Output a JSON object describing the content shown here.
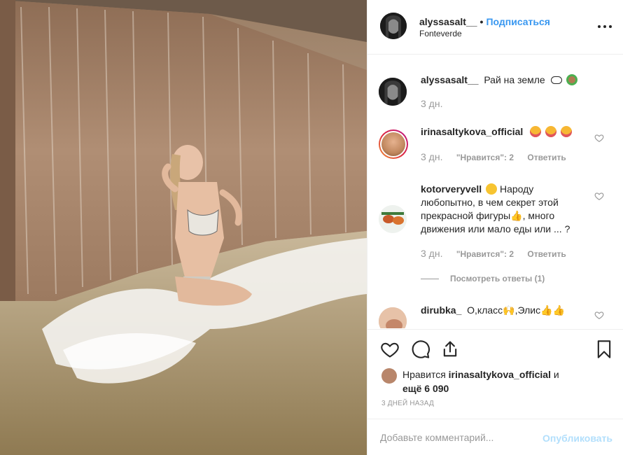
{
  "post": {
    "username": "alyssasalt__",
    "follow_label": "Подписаться",
    "dot": "•",
    "location": "Fonteverde",
    "photo_alt": "Woman sitting under a waterfall fountain"
  },
  "comments": [
    {
      "username": "alyssasalt__",
      "text": "Рай на земле",
      "emojis": [
        "cloud",
        "monkey"
      ],
      "time": "3 дн.",
      "likes": "",
      "reply": ""
    },
    {
      "username": "irinasaltykova_official",
      "text": "",
      "emojis": [
        "tongue-face",
        "tongue-face",
        "tongue-face"
      ],
      "time": "3 дн.",
      "likes": "\"Нравится\": 2",
      "reply": "Ответить"
    },
    {
      "username": "kotorveryvell",
      "text": "Народу любопытно, в чем секрет этой прекрасной фигуры👍, много движения или мало еды или ... ?",
      "emojis": [
        "thinking-face"
      ],
      "time": "3 дн.",
      "likes": "\"Нравится\": 2",
      "reply": "Ответить"
    },
    {
      "username": "dirubka_",
      "text": "О,класс🙌,Элис👍👍",
      "emojis": [],
      "time": "",
      "likes": "",
      "reply": ""
    }
  ],
  "view_replies": "Посмотреть ответы (1)",
  "actions": {
    "like_icon": "heart-icon",
    "comment_icon": "comment-icon",
    "share_icon": "share-icon",
    "save_icon": "bookmark-icon"
  },
  "likes": {
    "prefix": "Нравится",
    "user": "irinasaltykova_official",
    "middle": "и",
    "count": "ещё 6 090"
  },
  "when": "3 ДНЕЙ НАЗАД",
  "add_comment": {
    "placeholder": "Добавьте комментарий...",
    "publish_label": "Опубликовать"
  },
  "colors": {
    "accent": "#3897f0",
    "publish_disabled": "#b2dffc",
    "muted": "#999999",
    "border": "#efefef"
  }
}
